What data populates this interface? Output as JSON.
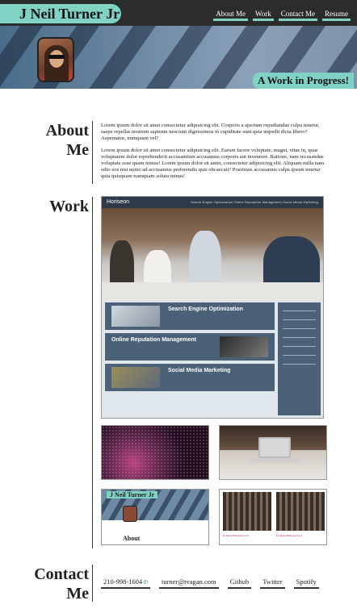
{
  "header": {
    "brand": "J Neil Turner Jr",
    "nav": [
      "About Me",
      "Work",
      "Contact Me",
      "Resume"
    ]
  },
  "hero": {
    "banner": "A Work in Progress!"
  },
  "about": {
    "title_line1": "About",
    "title_line2": "Me",
    "paragraphs": [
      "Lorem ipsum dolor sit amet consectetur adipisicing elit. Corporis a aperiam repudiandae culpa tenetur, saepe repellat nostrum sapiente nesciunt dignissimos in cupiditate sunt quia impedit dicta libero? Aspernatur, numquam vel?",
      "Lorem ipsum dolor sit amet consectetur adipisicing elit. Earum facere voluptate, magni, vitae in, quae voluptatem dolor reprehenderit accusantium accusamus corporis aut inventore. Ratione, nam recusandae voluptate esse quam minus! Lorem ipsum dolor sit amet, consectetur adipisicing elit. Aliquam nulla nam odio eos nisi nemo ad accusamus perferendis quis obcaecati? Possimus accusamus culpa ipsum tenetur quia quisquam numquam soluta minus!"
    ]
  },
  "work": {
    "title": "Work",
    "featured": {
      "brand": "Horiseon",
      "nav": "Search Engine Optimization    Online Reputation Management    Social Media Marketing",
      "cards": [
        "Search Engine Optimization",
        "Online Reputation Management",
        "Social Media Marketing"
      ]
    },
    "mini_brand": "J Neil Turner Jr",
    "mini_about": "About",
    "caption_a": "In latest mini-post tool.",
    "caption_b": "In latest mini-post tool."
  },
  "contact": {
    "title_line1": "Contact",
    "title_line2": "Me",
    "links": [
      "210-998-1604",
      "turner@reagan.com",
      "Github",
      "Twitter",
      "Spotify"
    ]
  }
}
